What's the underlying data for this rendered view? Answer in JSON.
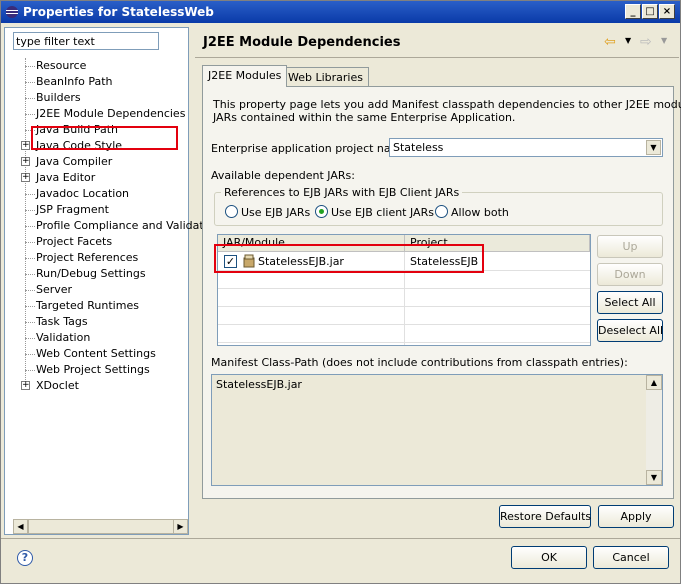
{
  "window": {
    "title": "Properties for StatelessWeb",
    "controls": [
      "minimize-icon",
      "maximize-icon",
      "close-icon"
    ]
  },
  "filter": {
    "value": "type filter text"
  },
  "tree": {
    "items": [
      {
        "label": "Resource",
        "expandable": false
      },
      {
        "label": "BeanInfo Path",
        "expandable": false
      },
      {
        "label": "Builders",
        "expandable": false
      },
      {
        "label": "J2EE Module Dependencies",
        "expandable": false,
        "selected": true
      },
      {
        "label": "Java Build Path",
        "expandable": false
      },
      {
        "label": "Java Code Style",
        "expandable": true
      },
      {
        "label": "Java Compiler",
        "expandable": true
      },
      {
        "label": "Java Editor",
        "expandable": true
      },
      {
        "label": "Javadoc Location",
        "expandable": false
      },
      {
        "label": "JSP Fragment",
        "expandable": false
      },
      {
        "label": "Profile Compliance and Validatic",
        "expandable": false
      },
      {
        "label": "Project Facets",
        "expandable": false
      },
      {
        "label": "Project References",
        "expandable": false
      },
      {
        "label": "Run/Debug Settings",
        "expandable": false
      },
      {
        "label": "Server",
        "expandable": false
      },
      {
        "label": "Targeted Runtimes",
        "expandable": false
      },
      {
        "label": "Task Tags",
        "expandable": false
      },
      {
        "label": "Validation",
        "expandable": false
      },
      {
        "label": "Web Content Settings",
        "expandable": false
      },
      {
        "label": "Web Project Settings",
        "expandable": false
      },
      {
        "label": "XDoclet",
        "expandable": true
      }
    ]
  },
  "page": {
    "title": "J2EE Module Dependencies",
    "tabs": [
      {
        "label": "J2EE Modules",
        "active": true
      },
      {
        "label": "Web Libraries",
        "active": false
      }
    ],
    "description_line1": "This property page lets you add Manifest classpath dependencies to other J2EE modules or",
    "description_line2": "JARs contained within the same Enterprise Application.",
    "ear_label": "Enterprise application project name:",
    "ear_value": "Stateless",
    "available_label": "Available dependent JARs:",
    "group_legend": "References to EJB JARs with EJB Client JARs",
    "radio_options": [
      {
        "label": "Use EJB JARs",
        "selected": false
      },
      {
        "label": "Use EJB client JARs",
        "selected": true
      },
      {
        "label": "Allow both",
        "selected": false
      }
    ],
    "table": {
      "columns": [
        "JAR/Module",
        "Project"
      ],
      "rows": [
        {
          "jar": "StatelessEJB.jar",
          "project": "StatelessEJB",
          "checked": true
        }
      ]
    },
    "side_buttons": {
      "up": "Up",
      "down": "Down",
      "select_all": "Select All",
      "deselect_all": "Deselect All"
    },
    "manifest_label": "Manifest Class-Path (does not include contributions from classpath entries):",
    "manifest_value": "StatelessEJB.jar",
    "restore_defaults": "Restore Defaults",
    "apply": "Apply"
  },
  "footer": {
    "ok": "OK",
    "cancel": "Cancel"
  },
  "colors": {
    "highlight_box": "#e3000e",
    "titlebar": "#0a3aa8"
  }
}
